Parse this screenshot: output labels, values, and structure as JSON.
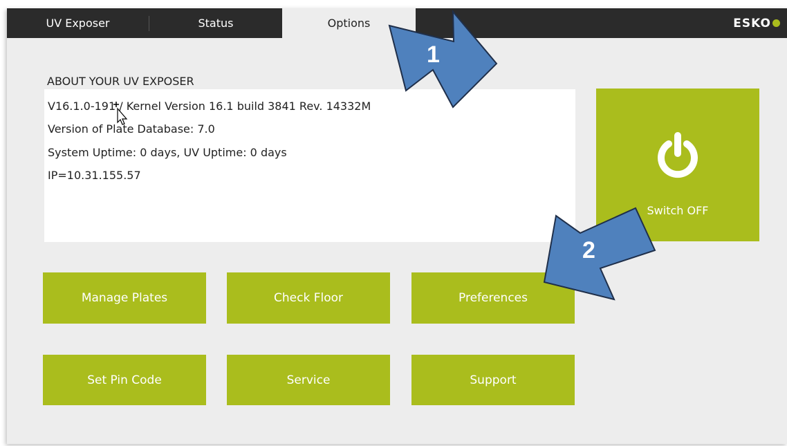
{
  "tabs": [
    {
      "label": "UV Exposer",
      "active": false
    },
    {
      "label": "Status",
      "active": false
    },
    {
      "label": "Options",
      "active": true
    }
  ],
  "brand": "ESKO",
  "about": {
    "title": "ABOUT YOUR UV EXPOSER",
    "lines": [
      "V16.1.0-191 / Kernel Version 16.1 build 3841 Rev. 14332M",
      "Version of Plate Database: 7.0",
      "System Uptime: 0 days, UV Uptime: 0 days",
      "IP=10.31.155.57"
    ]
  },
  "power": {
    "label": "Switch OFF",
    "icon": "power-icon"
  },
  "buttons": {
    "manage_plates": "Manage Plates",
    "check_floor": "Check Floor",
    "preferences": "Preferences",
    "set_pin_code": "Set Pin Code",
    "service": "Service",
    "support": "Support"
  },
  "callouts": {
    "one": "1",
    "two": "2"
  },
  "colors": {
    "accent": "#aabd1d",
    "topbar": "#2b2b2b",
    "background": "#ededed",
    "callout_arrow": "#4f81bd"
  }
}
